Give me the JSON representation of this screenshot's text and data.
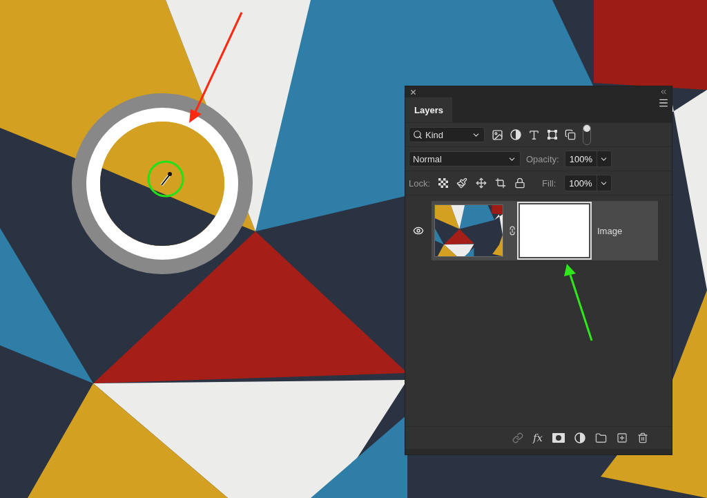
{
  "panel": {
    "tab": {
      "label": "Layers",
      "selected": true
    },
    "filter": {
      "value": "Kind",
      "toggle_on": true
    },
    "blend_mode": {
      "value": "Normal"
    },
    "opacity": {
      "label": "Opacity:",
      "value": "100%"
    },
    "lock": {
      "label": "Lock:"
    },
    "fill": {
      "label": "Fill:",
      "value": "100%"
    },
    "layers": [
      {
        "name": "Image",
        "visible": true,
        "selected": true
      }
    ],
    "footer": {
      "fx": "fx"
    }
  }
}
